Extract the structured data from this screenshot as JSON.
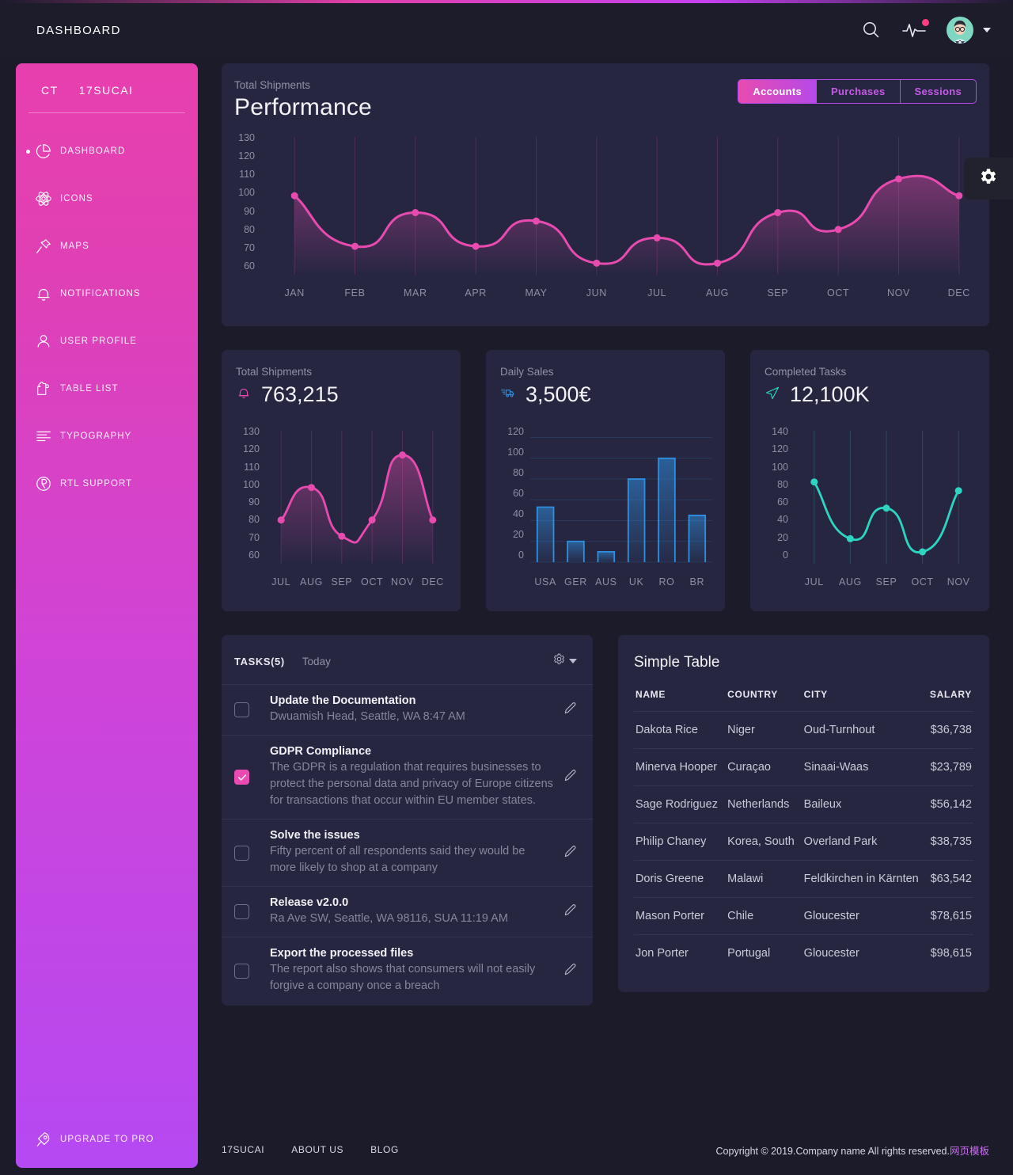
{
  "header": {
    "title": "DASHBOARD",
    "search_icon": "search-icon",
    "pulse_icon": "pulse-icon",
    "avatar_icon": "avatar"
  },
  "sidebar": {
    "brand_short": "CT",
    "brand_name": "17SUCAI",
    "items": [
      {
        "label": "DASHBOARD",
        "icon": "pie-chart-icon",
        "active": true
      },
      {
        "label": "ICONS",
        "icon": "atom-icon",
        "active": false
      },
      {
        "label": "MAPS",
        "icon": "pin-icon",
        "active": false
      },
      {
        "label": "NOTIFICATIONS",
        "icon": "bell-icon",
        "active": false
      },
      {
        "label": "USER PROFILE",
        "icon": "user-icon",
        "active": false
      },
      {
        "label": "TABLE LIST",
        "icon": "puzzle-icon",
        "active": false
      },
      {
        "label": "TYPOGRAPHY",
        "icon": "typography-icon",
        "active": false
      },
      {
        "label": "RTL SUPPORT",
        "icon": "globe-icon",
        "active": false
      }
    ],
    "upgrade": {
      "label": "UPGRADE TO PRO",
      "icon": "rocket-icon"
    }
  },
  "performance": {
    "subtitle": "Total Shipments",
    "title": "Performance",
    "buttons": [
      {
        "label": "Accounts",
        "active": true
      },
      {
        "label": "Purchases",
        "active": false
      },
      {
        "label": "Sessions",
        "active": false
      }
    ]
  },
  "settings_fab": {
    "icon": "gear-icon"
  },
  "stat_cards": [
    {
      "label": "Total Shipments",
      "value": "763,215",
      "icon": "bell-icon",
      "icon_color": "#e84bb0"
    },
    {
      "label": "Daily Sales",
      "value": "3,500€",
      "icon": "truck-icon",
      "icon_color": "#2e8fe0"
    },
    {
      "label": "Completed Tasks",
      "value": "12,100K",
      "icon": "send-icon",
      "icon_color": "#2dd4bf"
    }
  ],
  "tasks": {
    "title": "TASKS(5)",
    "subtitle": "Today",
    "gear_icon": "gear-icon",
    "items": [
      {
        "title": "Update the Documentation",
        "desc": "Dwuamish Head, Seattle, WA 8:47 AM",
        "checked": false
      },
      {
        "title": "GDPR Compliance",
        "desc": "The GDPR is a regulation that requires businesses to protect the personal data and privacy of Europe citizens for transactions that occur within EU member states.",
        "checked": true
      },
      {
        "title": "Solve the issues",
        "desc": "Fifty percent of all respondents said they would be more likely to shop at a company",
        "checked": false
      },
      {
        "title": "Release v2.0.0",
        "desc": "Ra Ave SW, Seattle, WA 98116, SUA 11:19 AM",
        "checked": false
      },
      {
        "title": "Export the processed files",
        "desc": "The report also shows that consumers will not easily forgive a company once a breach",
        "checked": false
      }
    ]
  },
  "simple_table": {
    "title": "Simple Table",
    "columns": [
      "NAME",
      "COUNTRY",
      "CITY",
      "SALARY"
    ],
    "rows": [
      [
        "Dakota Rice",
        "Niger",
        "Oud-Turnhout",
        "$36,738"
      ],
      [
        "Minerva Hooper",
        "Curaçao",
        "Sinaai-Waas",
        "$23,789"
      ],
      [
        "Sage Rodriguez",
        "Netherlands",
        "Baileux",
        "$56,142"
      ],
      [
        "Philip Chaney",
        "Korea, South",
        "Overland Park",
        "$38,735"
      ],
      [
        "Doris Greene",
        "Malawi",
        "Feldkirchen in Kärnten",
        "$63,542"
      ],
      [
        "Mason Porter",
        "Chile",
        "Gloucester",
        "$78,615"
      ],
      [
        "Jon Porter",
        "Portugal",
        "Gloucester",
        "$98,615"
      ]
    ]
  },
  "footer": {
    "links": [
      "17SUCAI",
      "ABOUT US",
      "BLOG"
    ],
    "copyright": "Copyright © 2019.Company name All rights reserved.",
    "copyright_cn": "网页模板"
  },
  "colors": {
    "pink": "#e84bb0",
    "purple": "#b549f2",
    "blue": "#2e8fe0",
    "teal": "#2dd4bf",
    "card_bg": "#262640",
    "page_bg": "#1b1b2a"
  },
  "chart_data": [
    {
      "type": "line",
      "name": "performance",
      "title": "Performance",
      "subtitle": "Total Shipments",
      "categories": [
        "JAN",
        "FEB",
        "MAR",
        "APR",
        "MAY",
        "JUN",
        "JUL",
        "AUG",
        "SEP",
        "OCT",
        "NOV",
        "DEC"
      ],
      "values": [
        100,
        70,
        90,
        70,
        85,
        60,
        75,
        60,
        90,
        80,
        110,
        100
      ],
      "yticks": [
        130,
        120,
        110,
        100,
        90,
        80,
        70,
        60
      ],
      "ylim": [
        55,
        133
      ],
      "xlabel": "",
      "ylabel": "",
      "grid": "vertical",
      "color": "#e84bb0",
      "legend": "none"
    },
    {
      "type": "line",
      "name": "total-shipments",
      "title": "Total Shipments",
      "categories": [
        "JUL",
        "AUG",
        "SEP",
        "OCT",
        "NOV",
        "DEC"
      ],
      "values": [
        80,
        100,
        70,
        80,
        120,
        80
      ],
      "yticks": [
        130,
        120,
        110,
        100,
        90,
        80,
        70,
        60
      ],
      "ylim": [
        55,
        133
      ],
      "xlabel": "",
      "ylabel": "",
      "grid": "vertical",
      "color": "#e84bb0",
      "legend": "none"
    },
    {
      "type": "bar",
      "name": "daily-sales",
      "title": "Daily Sales",
      "categories": [
        "USA",
        "GER",
        "AUS",
        "UK",
        "RO",
        "BR"
      ],
      "values": [
        53,
        20,
        10,
        80,
        100,
        45
      ],
      "yticks": [
        120,
        100,
        80,
        60,
        40,
        20,
        0
      ],
      "ylim": [
        0,
        125
      ],
      "xlabel": "",
      "ylabel": "",
      "grid": "horizontal",
      "color": "#2e8fe0",
      "legend": "none"
    },
    {
      "type": "line",
      "name": "completed-tasks",
      "title": "Completed Tasks",
      "categories": [
        "JUL",
        "AUG",
        "SEP",
        "OCT",
        "NOV"
      ],
      "values": [
        90,
        25,
        60,
        10,
        80
      ],
      "yticks": [
        140,
        120,
        100,
        80,
        60,
        40,
        20,
        0
      ],
      "ylim": [
        0,
        145
      ],
      "xlabel": "",
      "ylabel": "",
      "grid": "vertical",
      "color": "#2dd4bf",
      "legend": "none"
    }
  ]
}
